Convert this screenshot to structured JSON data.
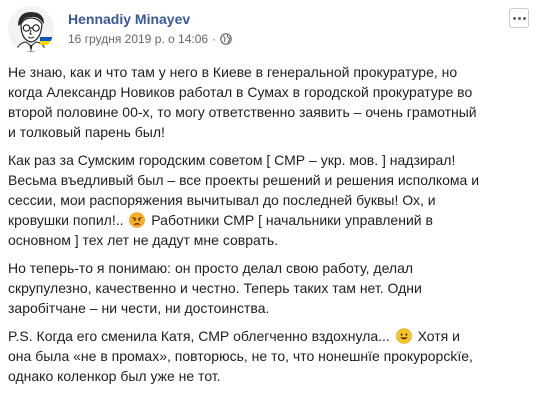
{
  "post": {
    "author": "Hennadiy Minayev",
    "date": "16 грудня 2019 р. о 14:06",
    "separator": "·",
    "privacy_icon": "globe-icon",
    "more_icon": "more-options-icon"
  },
  "paragraphs": [
    {
      "lines": [
        "Не знаю, как и что там у него в Киеве в генеральной прокуратуре, но",
        "когда Александр Новиков работал в Сумах в городской прокуратуре во",
        "второй половине 00-х, то могу ответственно заявить – очень грамотный",
        "и толковый парень был!"
      ]
    },
    {
      "lines": [
        "Как раз за Сумским городским советом [ СМР – укр. мов. ] надзирал!",
        "Весьма въедливый был – все проекты решений и решения исполкома и",
        "сессии, мои распоряжения вычитывал до последней буквы! Ох, и",
        "кровушки попил!..",
        "Работники СМР [ начальники управлений в",
        "основном ] тех лет не дадут мне соврать."
      ],
      "emoji_after_line": 3,
      "emoji": "angry-face-icon"
    },
    {
      "lines": [
        "Но теперь-то я понимаю: он просто делал свою работу, делал",
        "скрупулезно, качественно и честно. Теперь таких там нет. Одни",
        "заробітчане – ни чести, ни достоинства."
      ]
    },
    {
      "lines": [
        "P.S. Когда его сменила Катя, СМР облегченно вздохнула...",
        "Хотя и",
        "она была «не в промах», повторюсь, не то, что нонешнїе прокурорсkїе,",
        "однако коленкор был уже не тот."
      ],
      "emoji_after_line": 0,
      "emoji": "smiling-face-icon"
    }
  ],
  "colors": {
    "author": "#385898",
    "meta": "#606770",
    "text": "#1c1e21",
    "flag_blue": "#0057b7",
    "flag_yellow": "#ffd700"
  }
}
